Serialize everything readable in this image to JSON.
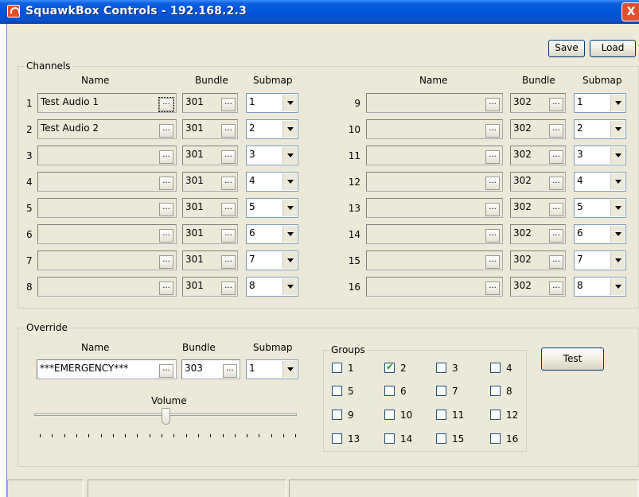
{
  "window": {
    "title": "SquawkBox Controls - 192.168.2.3",
    "close": "X"
  },
  "toolbar": {
    "save": "Save",
    "load": "Load"
  },
  "channels": {
    "label": "Channels",
    "headers": {
      "name": "Name",
      "bundle": "Bundle",
      "submap": "Submap"
    },
    "dots": "...",
    "left": [
      {
        "num": "1",
        "name": "Test Audio 1",
        "bundle": "301",
        "submap": "1"
      },
      {
        "num": "2",
        "name": "Test Audio 2",
        "bundle": "301",
        "submap": "2"
      },
      {
        "num": "3",
        "name": "",
        "bundle": "301",
        "submap": "3"
      },
      {
        "num": "4",
        "name": "",
        "bundle": "301",
        "submap": "4"
      },
      {
        "num": "5",
        "name": "",
        "bundle": "301",
        "submap": "5"
      },
      {
        "num": "6",
        "name": "",
        "bundle": "301",
        "submap": "6"
      },
      {
        "num": "7",
        "name": "",
        "bundle": "301",
        "submap": "7"
      },
      {
        "num": "8",
        "name": "",
        "bundle": "301",
        "submap": "8"
      }
    ],
    "right": [
      {
        "num": "9",
        "name": "",
        "bundle": "302",
        "submap": "1"
      },
      {
        "num": "10",
        "name": "",
        "bundle": "302",
        "submap": "2"
      },
      {
        "num": "11",
        "name": "",
        "bundle": "302",
        "submap": "3"
      },
      {
        "num": "12",
        "name": "",
        "bundle": "302",
        "submap": "4"
      },
      {
        "num": "13",
        "name": "",
        "bundle": "302",
        "submap": "5"
      },
      {
        "num": "14",
        "name": "",
        "bundle": "302",
        "submap": "6"
      },
      {
        "num": "15",
        "name": "",
        "bundle": "302",
        "submap": "7"
      },
      {
        "num": "16",
        "name": "",
        "bundle": "302",
        "submap": "8"
      }
    ]
  },
  "override": {
    "label": "Override",
    "headers": {
      "name": "Name",
      "bundle": "Bundle",
      "submap": "Submap"
    },
    "name": "***EMERGENCY***",
    "bundle": "303",
    "submap": "1",
    "volume_label": "Volume",
    "volume_level": 0.5,
    "test": "Test"
  },
  "groups": {
    "label": "Groups",
    "items": [
      {
        "label": "1",
        "checked": false
      },
      {
        "label": "2",
        "checked": true
      },
      {
        "label": "3",
        "checked": false
      },
      {
        "label": "4",
        "checked": false
      },
      {
        "label": "5",
        "checked": false
      },
      {
        "label": "6",
        "checked": false
      },
      {
        "label": "7",
        "checked": false
      },
      {
        "label": "8",
        "checked": false
      },
      {
        "label": "9",
        "checked": false
      },
      {
        "label": "10",
        "checked": false
      },
      {
        "label": "11",
        "checked": false
      },
      {
        "label": "12",
        "checked": false
      },
      {
        "label": "13",
        "checked": false
      },
      {
        "label": "14",
        "checked": false
      },
      {
        "label": "15",
        "checked": false
      },
      {
        "label": "16",
        "checked": false
      }
    ]
  },
  "colors": {
    "titlebar": "#0454d8",
    "window_bg": "#ece9d8",
    "check_mark": "#21a121"
  }
}
